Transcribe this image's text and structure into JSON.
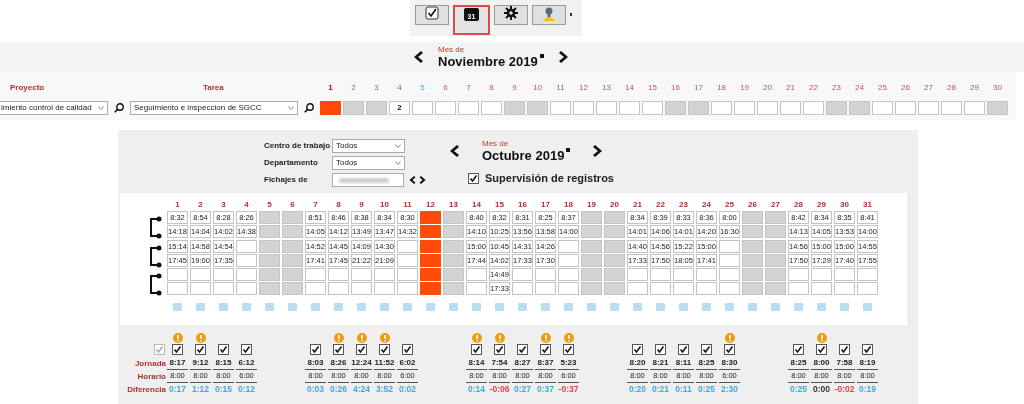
{
  "toolbar": [
    {
      "selected": false
    },
    {
      "label": "31",
      "selected": true
    },
    {
      "selected": false
    },
    {
      "selected": false
    }
  ],
  "project_month": {
    "caption": "Mes de",
    "month": "Noviembre 2019"
  },
  "project_table": {
    "columns": [
      "Proyecto",
      "Tarea"
    ],
    "project": "imiento control de calidad",
    "task": "Seguimiento e inspeccion de SGCC",
    "days": [
      {
        "label": "1",
        "kind": "holiday",
        "current": false
      },
      {
        "label": "2",
        "kind": "weekend",
        "current": false
      },
      {
        "label": "3",
        "kind": "weekend",
        "current": false
      },
      {
        "label": "4",
        "kind": "workday",
        "current": false,
        "value": "2"
      },
      {
        "label": "5",
        "kind": "workday",
        "current": true
      },
      {
        "label": "6",
        "kind": "workday",
        "current": false
      },
      {
        "label": "7",
        "kind": "workday",
        "current": false
      },
      {
        "label": "8",
        "kind": "workday",
        "current": false
      },
      {
        "label": "9",
        "kind": "weekend",
        "current": false
      },
      {
        "label": "10",
        "kind": "weekend",
        "current": false
      },
      {
        "label": "11",
        "kind": "workday",
        "current": false
      },
      {
        "label": "12",
        "kind": "workday",
        "current": false
      },
      {
        "label": "13",
        "kind": "workday",
        "current": false
      },
      {
        "label": "14",
        "kind": "workday",
        "current": false
      },
      {
        "label": "15",
        "kind": "workday",
        "current": false
      },
      {
        "label": "16",
        "kind": "weekend",
        "current": false
      },
      {
        "label": "17",
        "kind": "weekend",
        "current": false
      },
      {
        "label": "18",
        "kind": "workday",
        "current": false
      },
      {
        "label": "19",
        "kind": "workday",
        "current": false
      },
      {
        "label": "20",
        "kind": "workday",
        "current": false
      },
      {
        "label": "21",
        "kind": "workday",
        "current": false
      },
      {
        "label": "22",
        "kind": "workday",
        "current": false
      },
      {
        "label": "23",
        "kind": "weekend",
        "current": false
      },
      {
        "label": "24",
        "kind": "weekend",
        "current": false
      },
      {
        "label": "25",
        "kind": "workday",
        "current": false
      },
      {
        "label": "26",
        "kind": "workday",
        "current": false
      },
      {
        "label": "27",
        "kind": "workday",
        "current": false
      },
      {
        "label": "28",
        "kind": "workday",
        "current": false
      },
      {
        "label": "29",
        "kind": "workday",
        "current": false
      },
      {
        "label": "30",
        "kind": "weekend",
        "current": false
      }
    ]
  },
  "attendance": {
    "filters": [
      {
        "label": "Centro de trabajo",
        "kind": "select",
        "value": "Todos"
      },
      {
        "label": "Departamento",
        "kind": "select",
        "value": "Todos"
      },
      {
        "label": "Fichajes de",
        "kind": "person"
      }
    ],
    "caption": "Mes de",
    "month": "Octubre 2019",
    "supervision": {
      "label": "Supervisión de registros",
      "checked": true
    },
    "select_all": {
      "checked": true,
      "disabled": true
    },
    "summary_labels": [
      "Jornada",
      "Horario",
      "Diferencia"
    ],
    "days": [
      {
        "label": "1",
        "kind": "workday",
        "times": [
          "8:32",
          "14:18",
          "15:14",
          "17:45"
        ],
        "warning": true,
        "checked": true,
        "jornada": "8:17",
        "horario": "8:00",
        "diferencia": "0:17",
        "color": "#3fa9dc"
      },
      {
        "label": "2",
        "kind": "workday",
        "times": [
          "8:54",
          "14:04",
          "14:58",
          "19:00"
        ],
        "warning": true,
        "checked": true,
        "jornada": "9:12",
        "horario": "8:00",
        "diferencia": "1:12",
        "color": "#3fa9dc"
      },
      {
        "label": "3",
        "kind": "workday",
        "times": [
          "8:28",
          "14:02",
          "14:54",
          "17:35"
        ],
        "warning": false,
        "checked": true,
        "jornada": "8:15",
        "horario": "8:00",
        "diferencia": "0:15",
        "color": "#3fa9dc"
      },
      {
        "label": "4",
        "kind": "workday",
        "times": [
          "8:26",
          "14:38"
        ],
        "warning": false,
        "checked": true,
        "jornada": "6:12",
        "horario": "6:00",
        "diferencia": "0:12",
        "color": "#3fa9dc"
      },
      {
        "label": "5",
        "kind": "weekend"
      },
      {
        "label": "6",
        "kind": "weekend"
      },
      {
        "label": "7",
        "kind": "workday",
        "times": [
          "8:51",
          "14:05",
          "14:52",
          "17:41"
        ],
        "warning": false,
        "checked": true,
        "jornada": "8:03",
        "horario": "8:00",
        "diferencia": "0:03",
        "color": "#3fa9dc"
      },
      {
        "label": "8",
        "kind": "workday",
        "times": [
          "8:46",
          "14:12",
          "14:45",
          "17:45"
        ],
        "warning": true,
        "checked": true,
        "jornada": "8:26",
        "horario": "8:00",
        "diferencia": "0:26",
        "color": "#3fa9dc"
      },
      {
        "label": "9",
        "kind": "workday",
        "times": [
          "8:38",
          "13:49",
          "14:09",
          "21:22"
        ],
        "warning": true,
        "checked": true,
        "jornada": "12:24",
        "horario": "8:00",
        "diferencia": "4:24",
        "color": "#3fa9dc"
      },
      {
        "label": "10",
        "kind": "workday",
        "times": [
          "8:34",
          "13:47",
          "14:30",
          "21:09"
        ],
        "warning": true,
        "checked": true,
        "jornada": "11:52",
        "horario": "8:00",
        "diferencia": "3:52",
        "color": "#3fa9dc"
      },
      {
        "label": "11",
        "kind": "workday",
        "times": [
          "8:30",
          "14:32"
        ],
        "warning": false,
        "checked": true,
        "jornada": "6:02",
        "horario": "6:00",
        "diferencia": "0:02",
        "color": "#3fa9dc"
      },
      {
        "label": "12",
        "kind": "holiday"
      },
      {
        "label": "13",
        "kind": "weekend"
      },
      {
        "label": "14",
        "kind": "workday",
        "times": [
          "8:40",
          "14:10",
          "15:00",
          "17:44"
        ],
        "warning": true,
        "checked": true,
        "jornada": "8:14",
        "horario": "8:00",
        "diferencia": "0:14",
        "color": "#3fa9dc"
      },
      {
        "label": "15",
        "kind": "workday",
        "times": [
          "8:32",
          "10:25",
          "10:45",
          "14:02",
          "14:49",
          "17:33"
        ],
        "warning": true,
        "checked": true,
        "jornada": "7:54",
        "horario": "8:00",
        "diferencia": "-0:06",
        "color": "#e8404a"
      },
      {
        "label": "16",
        "kind": "workday",
        "times": [
          "8:31",
          "13:56",
          "14:31",
          "17:33"
        ],
        "warning": false,
        "checked": true,
        "jornada": "8:27",
        "horario": "8:00",
        "diferencia": "0:27",
        "color": "#3fa9dc"
      },
      {
        "label": "17",
        "kind": "workday",
        "times": [
          "8:25",
          "13:58",
          "14:26",
          "17:30"
        ],
        "warning": true,
        "checked": true,
        "jornada": "8:37",
        "horario": "8:00",
        "diferencia": "0:37",
        "color": "#3fa9dc"
      },
      {
        "label": "18",
        "kind": "workday",
        "times": [
          "8:37",
          "14:00"
        ],
        "warning": true,
        "checked": true,
        "jornada": "5:23",
        "horario": "6:00",
        "diferencia": "-0:37",
        "color": "#e8404a"
      },
      {
        "label": "19",
        "kind": "weekend"
      },
      {
        "label": "20",
        "kind": "weekend"
      },
      {
        "label": "21",
        "kind": "workday",
        "times": [
          "8:34",
          "14:01",
          "14:40",
          "17:33"
        ],
        "warning": false,
        "checked": true,
        "jornada": "8:20",
        "horario": "8:00",
        "diferencia": "0:20",
        "color": "#3fa9dc"
      },
      {
        "label": "22",
        "kind": "workday",
        "times": [
          "8:39",
          "14:06",
          "14:56",
          "17:50"
        ],
        "warning": false,
        "checked": true,
        "jornada": "8:21",
        "horario": "8:00",
        "diferencia": "0:21",
        "color": "#3fa9dc"
      },
      {
        "label": "23",
        "kind": "workday",
        "times": [
          "8:33",
          "14:01",
          "15:22",
          "18:05"
        ],
        "warning": false,
        "checked": true,
        "jornada": "8:11",
        "horario": "8:00",
        "diferencia": "0:11",
        "color": "#3fa9dc"
      },
      {
        "label": "24",
        "kind": "workday",
        "times": [
          "8:36",
          "14:20",
          "15:00",
          "17:41"
        ],
        "warning": false,
        "checked": true,
        "jornada": "8:25",
        "horario": "8:00",
        "diferencia": "0:25",
        "color": "#3fa9dc"
      },
      {
        "label": "25",
        "kind": "workday",
        "times": [
          "8:00",
          "16:30"
        ],
        "warning": true,
        "checked": true,
        "jornada": "8:30",
        "horario": "6:00",
        "diferencia": "2:30",
        "color": "#3fa9dc"
      },
      {
        "label": "26",
        "kind": "weekend"
      },
      {
        "label": "27",
        "kind": "weekend"
      },
      {
        "label": "28",
        "kind": "workday",
        "times": [
          "8:42",
          "14:13",
          "14:56",
          "17:50"
        ],
        "warning": false,
        "checked": true,
        "jornada": "8:25",
        "horario": "8:00",
        "diferencia": "0:25",
        "color": "#3fa9dc"
      },
      {
        "label": "29",
        "kind": "workday",
        "times": [
          "8:34",
          "14:05",
          "15:00",
          "17:29"
        ],
        "warning": true,
        "checked": true,
        "jornada": "8:00",
        "horario": "8:00",
        "diferencia": "0:00",
        "color": "#333333"
      },
      {
        "label": "30",
        "kind": "workday",
        "times": [
          "8:35",
          "13:53",
          "15:00",
          "17:40"
        ],
        "warning": false,
        "checked": true,
        "jornada": "7:58",
        "horario": "8:00",
        "diferencia": "-0:02",
        "color": "#e8404a"
      },
      {
        "label": "31",
        "kind": "workday",
        "times": [
          "8:41",
          "14:00",
          "14:55",
          "17:55"
        ],
        "warning": false,
        "checked": true,
        "jornada": "8:19",
        "horario": "8:00",
        "diferencia": "0:19",
        "color": "#3fa9dc"
      }
    ]
  }
}
